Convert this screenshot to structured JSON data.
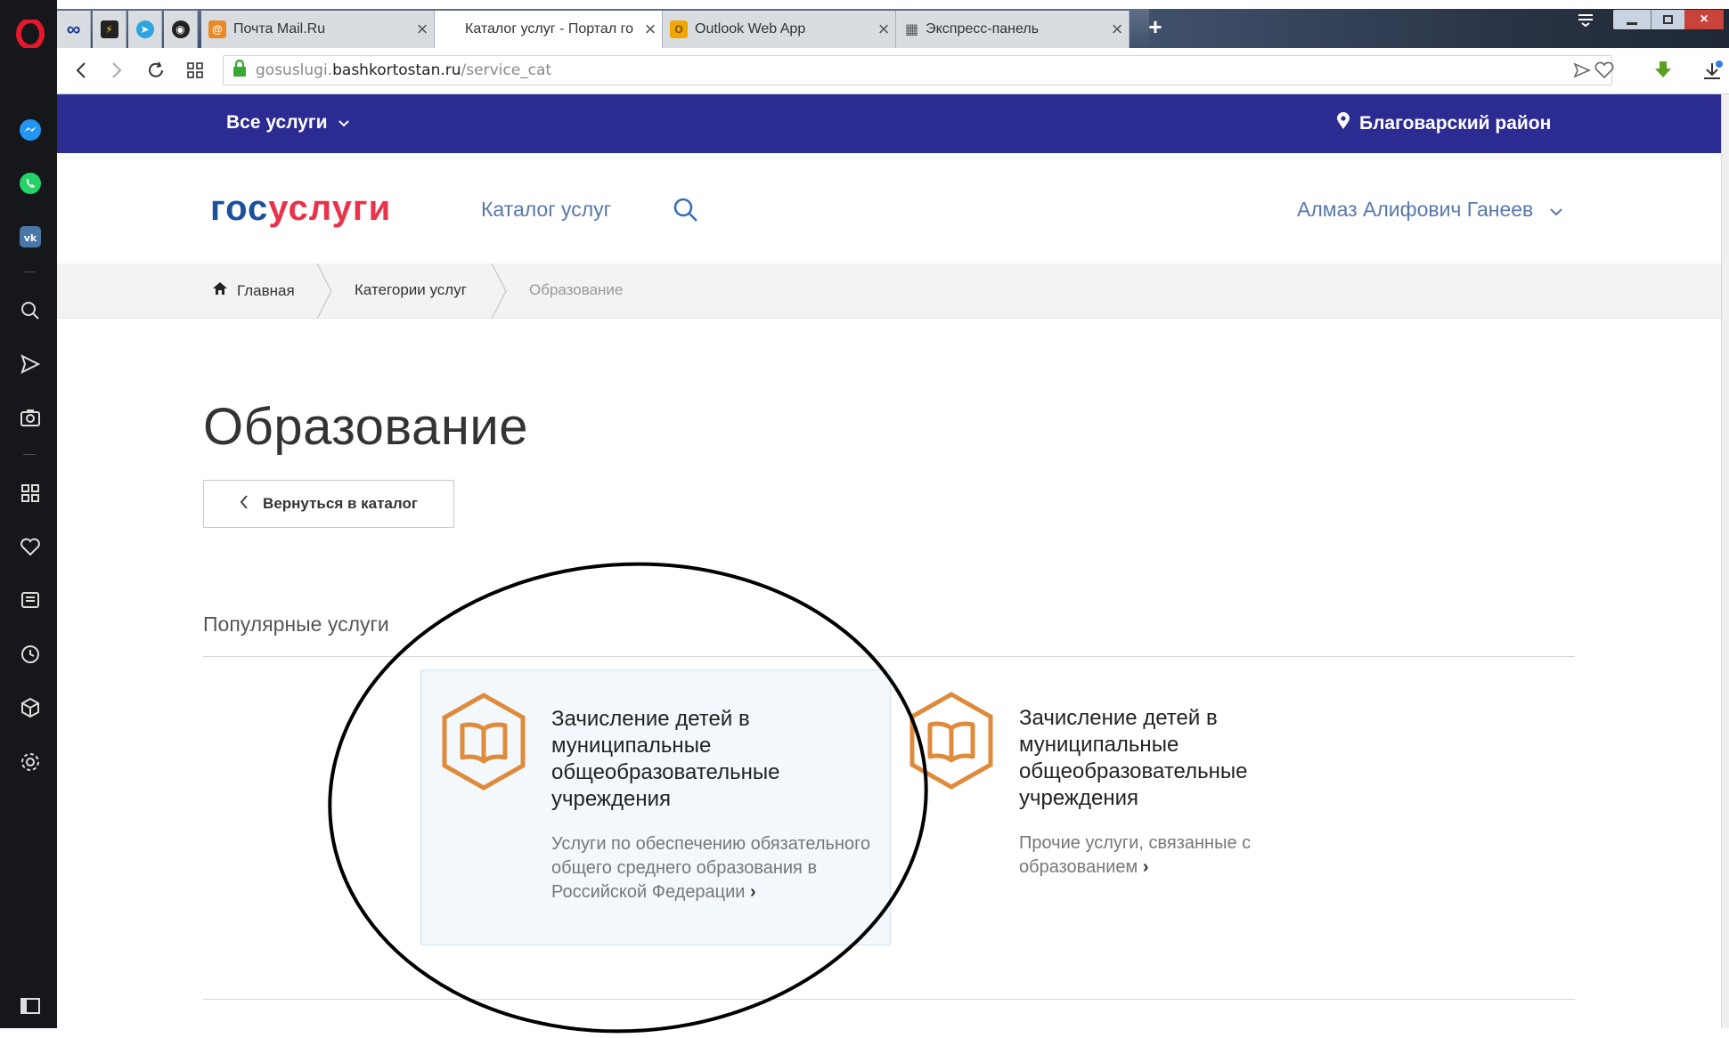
{
  "browser": {
    "tabs": [
      {
        "label": "Почта Mail.Ru",
        "icon": "mail-ru-icon",
        "active": false
      },
      {
        "label": "Каталог услуг - Портал го",
        "icon": "",
        "active": true
      },
      {
        "label": "Outlook Web App",
        "icon": "outlook-icon",
        "active": false
      },
      {
        "label": "Экспресс-панель",
        "icon": "speed-dial-icon",
        "active": false
      }
    ],
    "url_domain": "gosuslugi.bashkortostan.ru",
    "url_path": "/service_cat",
    "url_prefix": "gosuslugi."
  },
  "topstrip": {
    "all_services": "Все услуги",
    "region": "Благоварский район"
  },
  "header": {
    "logo_gos": "гос",
    "logo_uslugi": "услуги",
    "catalog": "Каталог услуг",
    "user": "Алмаз Алифович Ганеев"
  },
  "breadcrumbs": {
    "home": "Главная",
    "categories": "Категории услуг",
    "current": "Образование"
  },
  "main": {
    "title": "Образование",
    "back_button": "Вернуться в каталог",
    "popular_label": "Популярные услуги",
    "cards": [
      {
        "title": "Зачисление детей в муниципальные общеобразовательные учреждения",
        "description": "Услуги по обеспечению обязательного общего среднего образования в Российской Федерации",
        "icon": "book-icon"
      },
      {
        "title": "Зачисление детей в муниципальные общеобразовательные учреждения",
        "description": "Прочие услуги, связанные с образованием",
        "icon": "book-icon"
      }
    ]
  },
  "colors": {
    "topstrip": "#2b2b92",
    "logo_blue": "#1c4f9c",
    "logo_red": "#e9334a",
    "link": "#5778aa",
    "icon_orange": "#e08a3c"
  }
}
